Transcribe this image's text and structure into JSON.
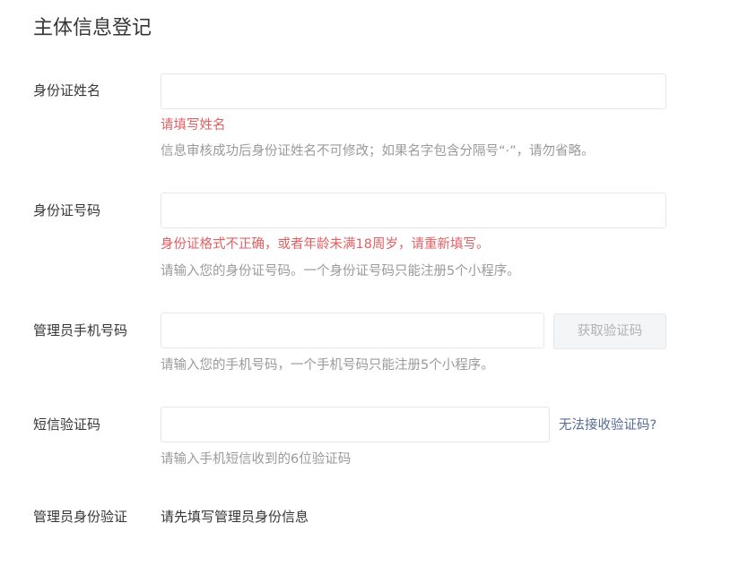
{
  "page": {
    "title": "主体信息登记"
  },
  "form": {
    "id_name": {
      "label": "身份证姓名",
      "value": "",
      "placeholder": "",
      "error": "请填写姓名",
      "tip": "信息审核成功后身份证姓名不可修改；如果名字包含分隔号“·”，请勿省略。"
    },
    "id_number": {
      "label": "身份证号码",
      "value": "",
      "placeholder": "",
      "error": "身份证格式不正确，或者年龄未满18周岁，请重新填写。",
      "tip": "请输入您的身份证号码。一个身份证号码只能注册5个小程序。"
    },
    "admin_phone": {
      "label": "管理员手机号码",
      "value": "",
      "placeholder": "",
      "get_code_label": "获取验证码",
      "tip": "请输入您的手机号码，一个手机号码只能注册5个小程序。"
    },
    "sms_code": {
      "label": "短信验证码",
      "value": "",
      "placeholder": "",
      "help_link": "无法接收验证码?",
      "tip": "请输入手机短信收到的6位验证码"
    },
    "admin_verify": {
      "label": "管理员身份验证",
      "value": "请先填写管理员身份信息"
    }
  },
  "colors": {
    "error": "#e15f63",
    "tip": "#9a9a9a",
    "link": "#576b95",
    "text": "#353535",
    "border": "#e7e7eb"
  }
}
